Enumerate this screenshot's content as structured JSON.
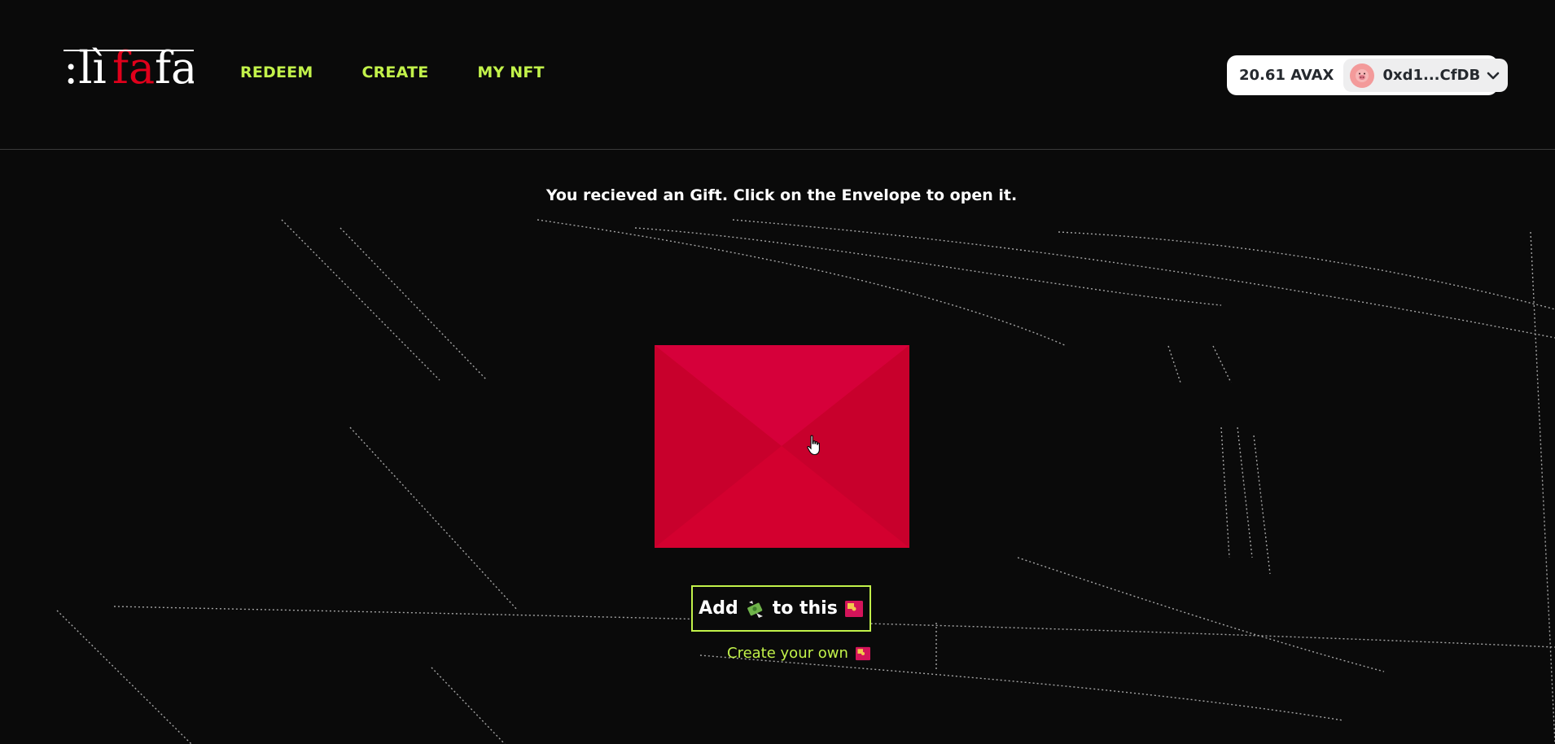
{
  "header": {
    "logo_text": "lifafa",
    "nav": [
      {
        "label": "REDEEM"
      },
      {
        "label": "CREATE"
      },
      {
        "label": "MY NFT"
      }
    ],
    "wallet": {
      "balance": "20.61 AVAX",
      "address": "0xd1...CfDB"
    }
  },
  "main": {
    "message": "You recieved an Gift. Click on the Envelope to open it.",
    "add_button": {
      "prefix": "Add",
      "suffix": "to this"
    },
    "create_link": "Create your own"
  },
  "colors": {
    "accent": "#c2f24a",
    "envelope": "#d0002f",
    "background": "#0a0a0a"
  }
}
